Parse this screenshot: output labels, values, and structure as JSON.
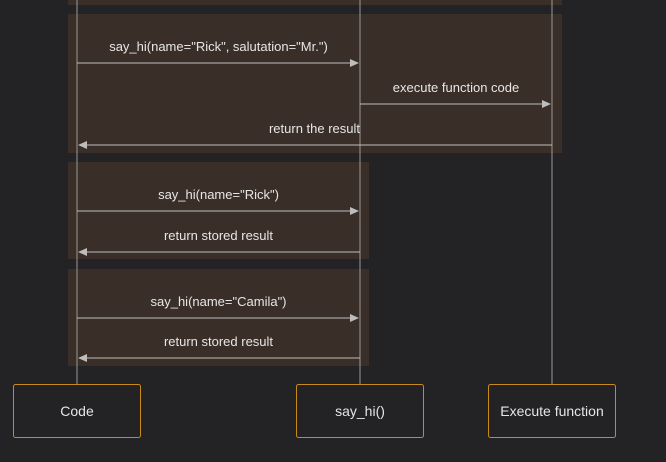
{
  "colors": {
    "background": "#232326",
    "group_fill": "#3a2f28",
    "line": "#bdbdbd",
    "text": "#e6e6e6",
    "box_border": "#c98a1a"
  },
  "participants": [
    {
      "id": "code",
      "label": "Code"
    },
    {
      "id": "say_hi",
      "label": "say_hi()"
    },
    {
      "id": "exec",
      "label": "Execute function"
    }
  ],
  "groups": [
    {
      "messages": [
        {
          "from": "code",
          "to": "say_hi",
          "label": "say_hi(name=\"Rick\", salutation=\"Mr.\")"
        },
        {
          "from": "say_hi",
          "to": "exec",
          "label": "execute function code"
        },
        {
          "from": "exec",
          "to": "code",
          "label": "return the result"
        }
      ]
    },
    {
      "messages": [
        {
          "from": "code",
          "to": "say_hi",
          "label": "say_hi(name=\"Rick\")"
        },
        {
          "from": "say_hi",
          "to": "code",
          "label": "return stored result"
        }
      ]
    },
    {
      "messages": [
        {
          "from": "code",
          "to": "say_hi",
          "label": "say_hi(name=\"Camila\")"
        },
        {
          "from": "say_hi",
          "to": "code",
          "label": "return stored result"
        }
      ]
    }
  ]
}
